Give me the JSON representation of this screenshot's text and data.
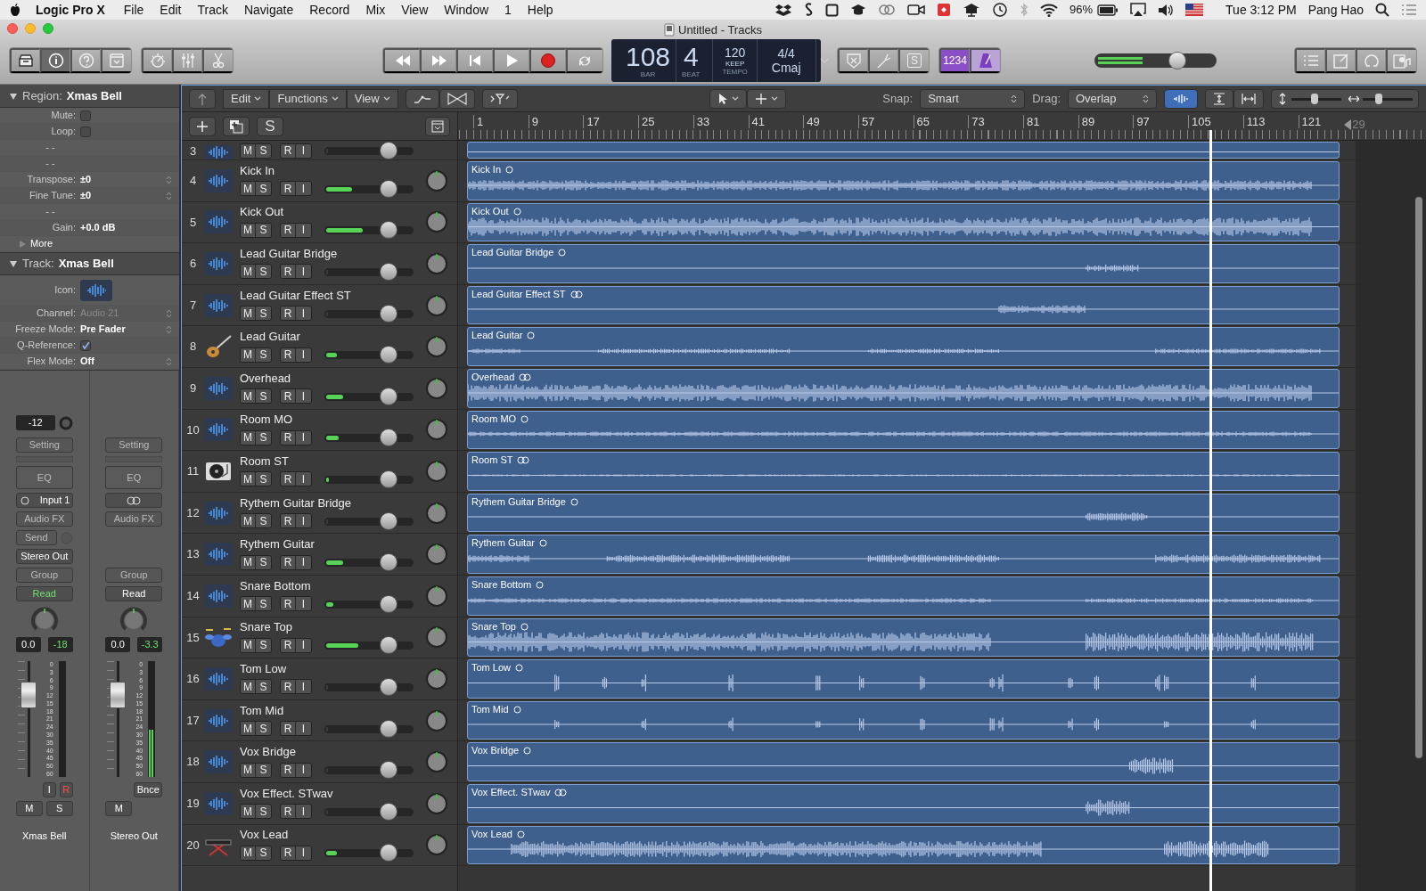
{
  "menu_bar": {
    "app": "Logic Pro X",
    "menus": [
      "File",
      "Edit",
      "Track",
      "Navigate",
      "Record",
      "Mix",
      "View",
      "Window",
      "1",
      "Help"
    ],
    "battery": "96%",
    "clock": "Tue 3:12 PM",
    "user": "Pang Hao"
  },
  "window": {
    "title": "Untitled - Tracks"
  },
  "toolbar": {
    "inspector_selected": true,
    "lcd": {
      "bar": "108",
      "beat": "4",
      "bar_label": "BAR",
      "beat_label": "BEAT",
      "tempo": "120",
      "tempo_mode": "KEEP",
      "tempo_label": "TEMPO",
      "signature": "4/4",
      "key": "Cmaj"
    },
    "solo_button": "S",
    "count_in": {
      "label": "1234",
      "on": true
    },
    "metronome_on": true,
    "master_volume": {
      "level": 0.68
    }
  },
  "inspector": {
    "region": {
      "title": "Region:",
      "name": "Xmas Bell",
      "expanded": true,
      "rows": [
        {
          "kind": "check",
          "label": "Mute:",
          "checked": false
        },
        {
          "kind": "check",
          "label": "Loop:",
          "checked": false
        },
        {
          "kind": "dash",
          "label": "- -"
        },
        {
          "kind": "dash",
          "label": "- -"
        },
        {
          "kind": "stepper",
          "label": "Transpose:",
          "value": "±0"
        },
        {
          "kind": "stepper",
          "label": "Fine Tune:",
          "value": "±0"
        },
        {
          "kind": "dash",
          "label": "- -"
        },
        {
          "kind": "value",
          "label": "Gain:",
          "value": "+0.0 dB"
        }
      ],
      "more": {
        "label": "More",
        "expanded": false
      }
    },
    "track": {
      "title": "Track:",
      "name": "Xmas Bell",
      "expanded": true,
      "rows": [
        {
          "kind": "icon",
          "label": "Icon:"
        },
        {
          "kind": "stepper",
          "label": "Channel:",
          "value": "Audio 21",
          "disabled": true
        },
        {
          "kind": "stepper",
          "label": "Freeze Mode:",
          "value": "Pre Fader",
          "disabled": false
        },
        {
          "kind": "check",
          "label": "Q-Reference:",
          "checked": true
        },
        {
          "kind": "stepper",
          "label": "Flex Mode:",
          "value": "Off",
          "disabled": false
        }
      ]
    }
  },
  "channel_strips": [
    {
      "gain": "-12",
      "setting": "Setting",
      "eq": "EQ",
      "input": {
        "kind": "mono",
        "label": "Input 1"
      },
      "audio_fx": "Audio FX",
      "send": "Send",
      "output": "Stereo Out",
      "group": "Group",
      "automation": {
        "label": "Read",
        "active": true
      },
      "volume": "0.0",
      "peak": "-18",
      "fader": {
        "level": 0.71
      },
      "meter": {
        "level": 0
      },
      "meter_scale": [
        "0",
        "3",
        "6",
        "9",
        "12",
        "15",
        "18",
        "21",
        "24",
        "30",
        "35",
        "40",
        "45",
        "50",
        "60"
      ],
      "small_buttons": [
        {
          "label": "I",
          "on": false
        },
        {
          "label": "R",
          "on": true
        }
      ],
      "mute": "M",
      "solo": "S",
      "name": "Xmas Bell"
    },
    {
      "setting": "Setting",
      "eq": "EQ",
      "input": {
        "kind": "stereo"
      },
      "audio_fx": "Audio FX",
      "group": "Group",
      "automation": {
        "label": "Read",
        "active": false
      },
      "volume": "0.0",
      "peak": "-3.3",
      "fader": {
        "level": 0.71
      },
      "meter": {
        "level": 0.41
      },
      "meter_scale": [
        "0",
        "3",
        "6",
        "9",
        "12",
        "15",
        "18",
        "21",
        "24",
        "30",
        "35",
        "40",
        "45",
        "50",
        "60"
      ],
      "small_buttons": [
        {
          "label": "Bnce",
          "on": false
        }
      ],
      "mute": "M",
      "name": "Stereo Out"
    }
  ],
  "tracks_toolbar": {
    "menus": [
      "Edit",
      "Functions",
      "View"
    ],
    "snap_label": "Snap:",
    "snap": "Smart",
    "drag_label": "Drag:",
    "drag": "Overlap",
    "waveform_zoom_on": true,
    "vertical_zoom": {
      "level": 0.45
    },
    "horizontal_zoom": {
      "level": 0.3
    }
  },
  "track_header_bar": {
    "solo_button": "S"
  },
  "ruler": {
    "marks": [
      "1",
      "9",
      "17",
      "25",
      "33",
      "41",
      "49",
      "57",
      "65",
      "73",
      "81",
      "89",
      "97",
      "105",
      "113",
      "121",
      "29"
    ],
    "playhead": {
      "level": 0.777
    }
  },
  "tracks": [
    {
      "number": "3",
      "kind": "audio",
      "buttons": [
        "M",
        "S",
        "R",
        "I"
      ],
      "fader": {
        "level": 0.72
      },
      "meter": {
        "level": 0
      }
    },
    {
      "number": "4",
      "name": "Kick In",
      "kind": "audio",
      "buttons": [
        "M",
        "S",
        "R",
        "I"
      ],
      "fader": {
        "level": 0.72
      },
      "meter": {
        "level": 0.3
      },
      "region": {
        "name": "Kick In",
        "stereo": false
      }
    },
    {
      "number": "5",
      "name": "Kick Out",
      "kind": "audio",
      "buttons": [
        "M",
        "S",
        "R",
        "I"
      ],
      "fader": {
        "level": 0.72
      },
      "meter": {
        "level": 0.43
      },
      "region": {
        "name": "Kick Out",
        "stereo": false
      }
    },
    {
      "number": "6",
      "name": "Lead Guitar Bridge",
      "kind": "audio",
      "buttons": [
        "M",
        "S",
        "R",
        "I"
      ],
      "fader": {
        "level": 0.72
      },
      "meter": {
        "level": 0
      },
      "region": {
        "name": "Lead Guitar Bridge",
        "stereo": false
      }
    },
    {
      "number": "7",
      "name": "Lead Guitar Effect ST",
      "kind": "audio",
      "buttons": [
        "M",
        "S",
        "R",
        "I"
      ],
      "fader": {
        "level": 0.72
      },
      "meter": {
        "level": 0
      },
      "region": {
        "name": "Lead Guitar Effect ST",
        "stereo": true
      }
    },
    {
      "number": "8",
      "name": "Lead Guitar",
      "kind": "guitar",
      "buttons": [
        "M",
        "S",
        "R",
        "I"
      ],
      "fader": {
        "level": 0.72
      },
      "meter": {
        "level": 0.13
      },
      "region": {
        "name": "Lead Guitar",
        "stereo": false
      }
    },
    {
      "number": "9",
      "name": "Overhead",
      "kind": "audio",
      "buttons": [
        "M",
        "S",
        "R",
        "I"
      ],
      "fader": {
        "level": 0.72
      },
      "meter": {
        "level": 0.2
      },
      "region": {
        "name": "Overhead",
        "stereo": true
      }
    },
    {
      "number": "10",
      "name": "Room MO",
      "kind": "audio",
      "buttons": [
        "M",
        "S",
        "R",
        "I"
      ],
      "fader": {
        "level": 0.72
      },
      "meter": {
        "level": 0.15
      },
      "region": {
        "name": "Room MO",
        "stereo": false
      }
    },
    {
      "number": "11",
      "name": "Room ST",
      "kind": "turntable",
      "buttons": [
        "M",
        "S",
        "R",
        "I"
      ],
      "fader": {
        "level": 0.72
      },
      "meter": {
        "level": 0.03
      },
      "region": {
        "name": "Room ST",
        "stereo": true
      }
    },
    {
      "number": "12",
      "name": "Rythem Guitar Bridge",
      "kind": "audio",
      "buttons": [
        "M",
        "S",
        "R",
        "I"
      ],
      "fader": {
        "level": 0.72
      },
      "meter": {
        "level": 0
      },
      "region": {
        "name": "Rythem Guitar Bridge",
        "stereo": false
      }
    },
    {
      "number": "13",
      "name": "Rythem Guitar",
      "kind": "audio",
      "buttons": [
        "M",
        "S",
        "R",
        "I"
      ],
      "fader": {
        "level": 0.72
      },
      "meter": {
        "level": 0.2
      },
      "region": {
        "name": "Rythem Guitar",
        "stereo": false
      }
    },
    {
      "number": "14",
      "name": "Snare Bottom",
      "kind": "audio",
      "buttons": [
        "M",
        "S",
        "R",
        "I"
      ],
      "fader": {
        "level": 0.72
      },
      "meter": {
        "level": 0.08
      },
      "region": {
        "name": "Snare Bottom",
        "stereo": false
      }
    },
    {
      "number": "15",
      "name": "Snare Top",
      "kind": "drums",
      "buttons": [
        "M",
        "S",
        "R",
        "I"
      ],
      "fader": {
        "level": 0.72
      },
      "meter": {
        "level": 0.38
      },
      "region": {
        "name": "Snare Top",
        "stereo": false
      }
    },
    {
      "number": "16",
      "name": "Tom Low",
      "kind": "audio",
      "buttons": [
        "M",
        "S",
        "R",
        "I"
      ],
      "fader": {
        "level": 0.72
      },
      "meter": {
        "level": 0
      },
      "region": {
        "name": "Tom Low",
        "stereo": false
      }
    },
    {
      "number": "17",
      "name": "Tom Mid",
      "kind": "audio",
      "buttons": [
        "M",
        "S",
        "R",
        "I"
      ],
      "fader": {
        "level": 0.72
      },
      "meter": {
        "level": 0
      },
      "region": {
        "name": "Tom Mid",
        "stereo": false
      }
    },
    {
      "number": "18",
      "name": "Vox Bridge",
      "kind": "audio",
      "buttons": [
        "M",
        "S",
        "R",
        "I"
      ],
      "fader": {
        "level": 0.72
      },
      "meter": {
        "level": 0
      },
      "region": {
        "name": "Vox Bridge",
        "stereo": false
      }
    },
    {
      "number": "19",
      "name": "Vox Effect. STwav",
      "kind": "audio",
      "buttons": [
        "M",
        "S",
        "R",
        "I"
      ],
      "fader": {
        "level": 0.72
      },
      "meter": {
        "level": 0
      },
      "region": {
        "name": "Vox Effect. STwav",
        "stereo": true
      }
    },
    {
      "number": "20",
      "name": "Vox Lead",
      "kind": "keyboard",
      "buttons": [
        "M",
        "S",
        "R",
        "I"
      ],
      "fader": {
        "level": 0.72
      },
      "meter": {
        "level": 0.13
      },
      "region": {
        "name": "Vox Lead",
        "stereo": false
      }
    }
  ]
}
